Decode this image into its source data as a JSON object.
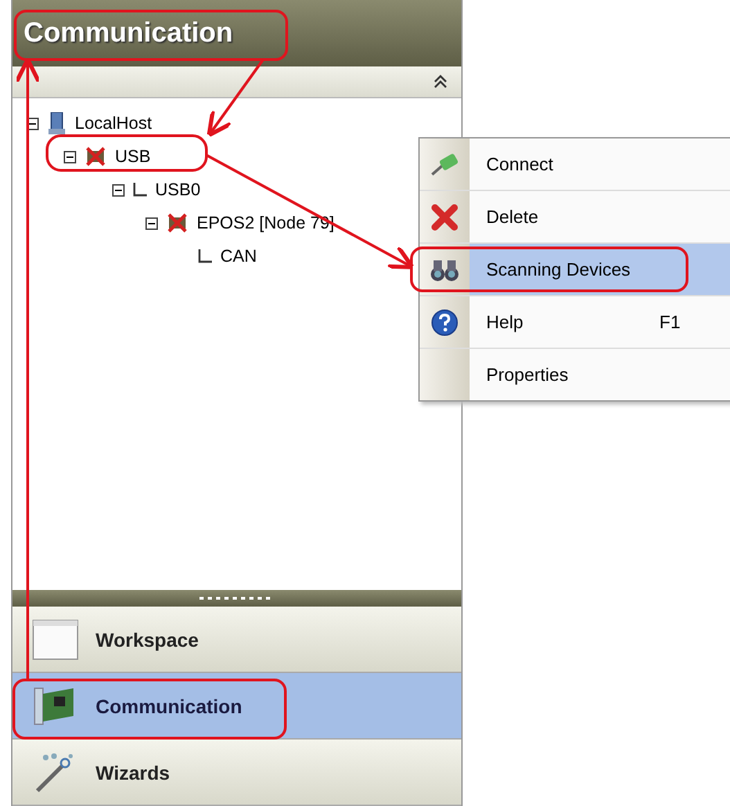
{
  "panel": {
    "title": "Communication"
  },
  "tree": [
    {
      "label": "LocalHost",
      "kind": "host",
      "expanded": true,
      "children": [
        {
          "label": "USB",
          "kind": "usb",
          "expanded": true,
          "children": [
            {
              "label": "USB0",
              "kind": "port",
              "expanded": true,
              "children": [
                {
                  "label": "EPOS2 [Node 79]",
                  "kind": "device",
                  "expanded": true,
                  "children": [
                    {
                      "label": "CAN",
                      "kind": "bus"
                    }
                  ]
                }
              ]
            }
          ]
        }
      ]
    }
  ],
  "context_menu": [
    {
      "label": "Connect",
      "kind": "connect",
      "selected": false
    },
    {
      "label": "Delete",
      "kind": "delete",
      "selected": false
    },
    {
      "label": "Scanning Devices",
      "kind": "scan",
      "selected": true
    },
    {
      "label": "Help",
      "kind": "help",
      "shortcut": "F1",
      "selected": false
    },
    {
      "label": "Properties",
      "kind": "none",
      "selected": false
    }
  ],
  "nav": [
    {
      "label": "Workspace",
      "kind": "workspace",
      "selected": false
    },
    {
      "label": "Communication",
      "kind": "communication",
      "selected": true
    },
    {
      "label": "Wizards",
      "kind": "wizards",
      "selected": false
    }
  ]
}
